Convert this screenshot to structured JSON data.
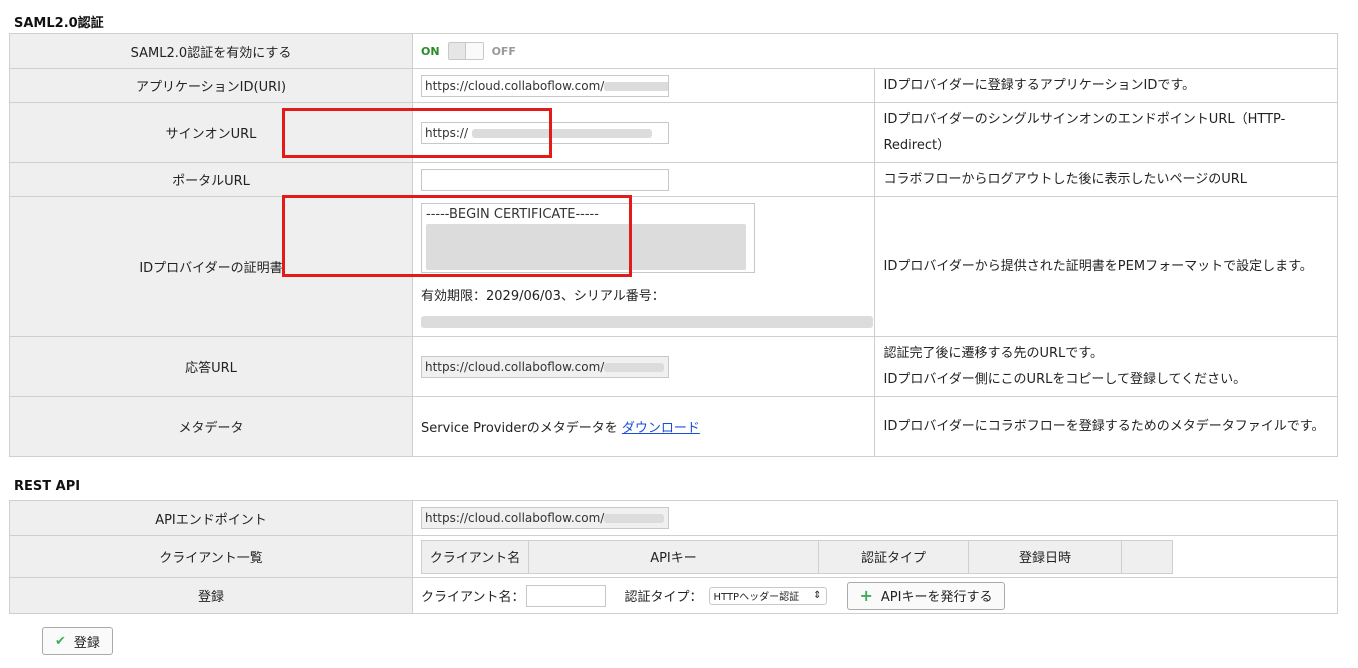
{
  "saml": {
    "section_title": "SAML2.0認証",
    "enable": {
      "label": "SAML2.0認証を有効にする",
      "on": "ON",
      "off": "OFF",
      "state": "on"
    },
    "app_id": {
      "label": "アプリケーションID(URI)",
      "value": "https://cloud.collaboflow.com/",
      "suffix": "/",
      "desc": "IDプロバイダーに登録するアプリケーションIDです。"
    },
    "signon": {
      "label": "サインオンURL",
      "value": "https://",
      "desc": "IDプロバイダーのシングルサインオンのエンドポイントURL（HTTP-Redirect）"
    },
    "portal": {
      "label": "ポータルURL",
      "value": "",
      "desc": "コラボフローからログアウトした後に表示したいページのURL"
    },
    "cert": {
      "label": "IDプロバイダーの証明書",
      "value": "-----BEGIN CERTIFICATE-----",
      "expiry": "有効期限：2029/06/03、シリアル番号：",
      "desc": "IDプロバイダーから提供された証明書をPEMフォーマットで設定します。"
    },
    "response": {
      "label": "応答URL",
      "value": "https://cloud.collaboflow.com/",
      "desc1": "認証完了後に遷移する先のURLです。",
      "desc2": "IDプロバイダー側にこのURLをコピーして登録してください。"
    },
    "metadata": {
      "label": "メタデータ",
      "text": "Service Providerのメタデータを",
      "link": "ダウンロード",
      "desc": "IDプロバイダーにコラボフローを登録するためのメタデータファイルです。"
    }
  },
  "rest": {
    "section_title": "REST API",
    "endpoint": {
      "label": "APIエンドポイント",
      "value": "https://cloud.collaboflow.com/"
    },
    "clients": {
      "label": "クライアント一覧",
      "headers": [
        "クライアント名",
        "APIキー",
        "認証タイプ",
        "登録日時",
        ""
      ]
    },
    "register": {
      "label": "登録",
      "client_name_label": "クライアント名：",
      "auth_type_label": "認証タイプ：",
      "auth_type_value": "HTTPヘッダー認証",
      "issue_button": "APIキーを発行する"
    }
  },
  "footer": {
    "save_button": "登録"
  },
  "colors": {
    "highlight": "#e31a1a",
    "accent_green": "#3fae5c",
    "link": "#1a4fd6"
  }
}
